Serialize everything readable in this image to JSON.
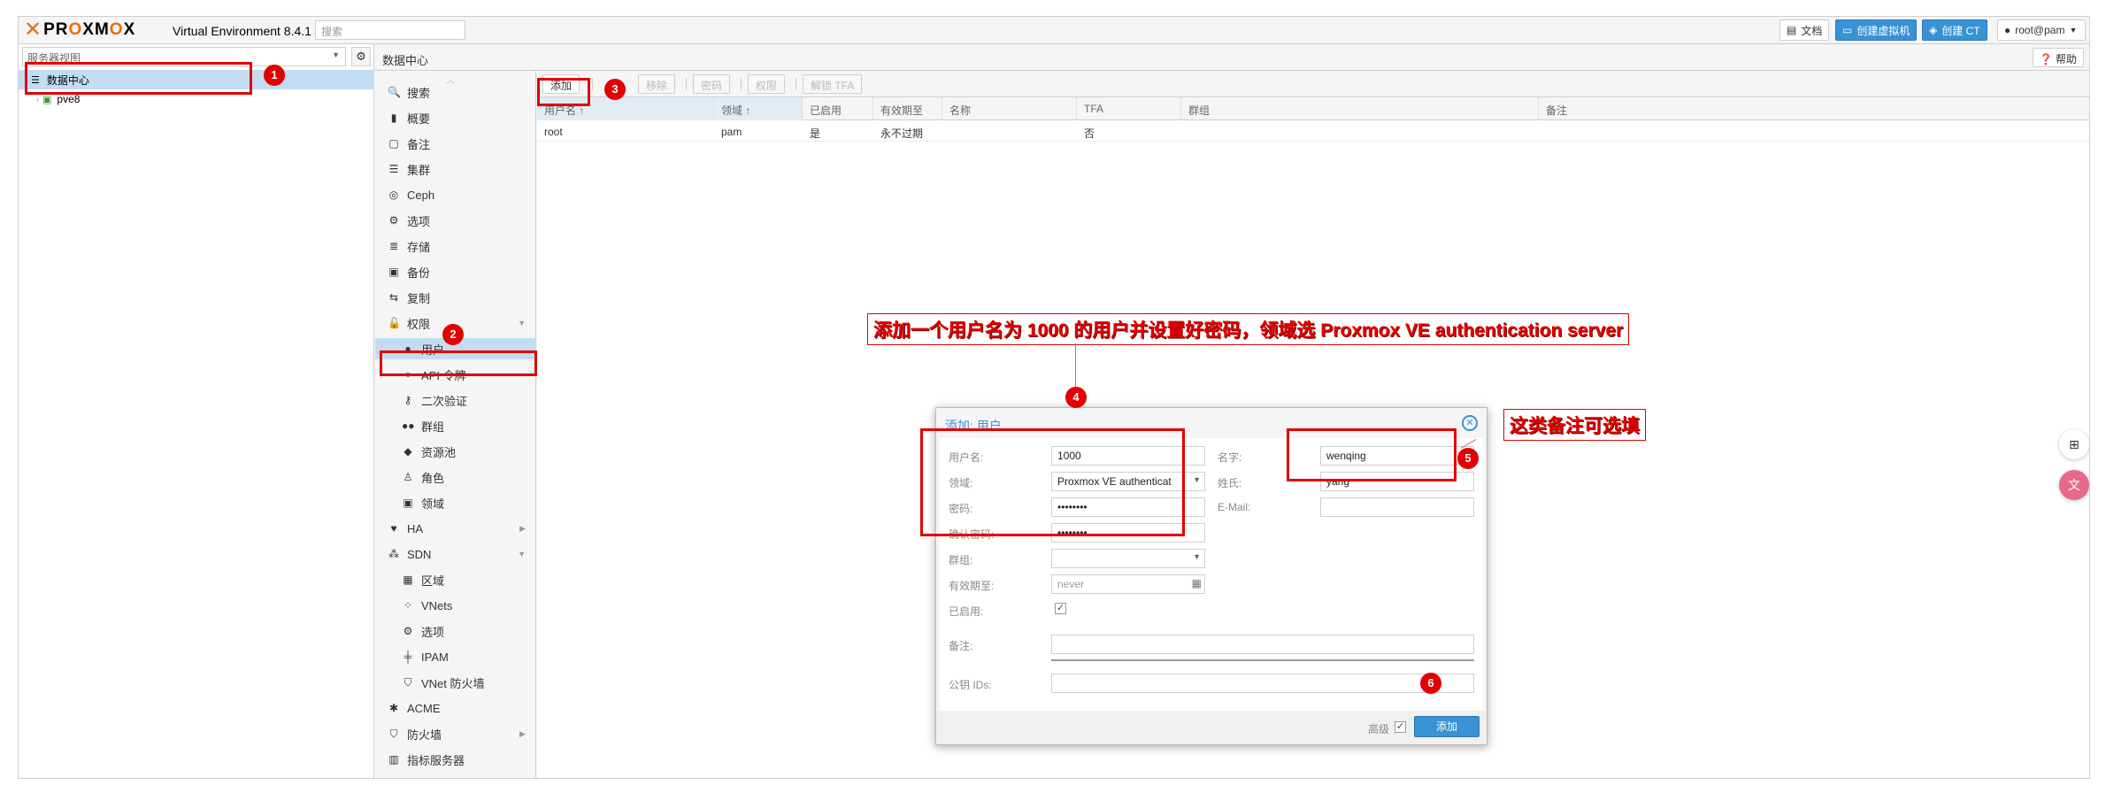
{
  "app": {
    "logo": "PROXMOX",
    "version": "Virtual Environment 8.4.1",
    "search_placeholder": "搜索"
  },
  "topbar": {
    "docs": "文档",
    "create_vm": "创建虚拟机",
    "create_ct": "创建 CT",
    "user": "root@pam"
  },
  "left": {
    "view": "服务器视图",
    "tree": [
      {
        "label": "数据中心"
      },
      {
        "label": "pve8"
      }
    ]
  },
  "content": {
    "breadcrumb": "数据中心",
    "help": "帮助"
  },
  "nav": [
    {
      "label": "搜索",
      "icon": "search-icon"
    },
    {
      "label": "概要",
      "icon": "book-icon"
    },
    {
      "label": "备注",
      "icon": "note-icon"
    },
    {
      "label": "集群",
      "icon": "server-icon"
    },
    {
      "label": "Ceph",
      "icon": "ceph-icon"
    },
    {
      "label": "选项",
      "icon": "gear-icon"
    },
    {
      "label": "存储",
      "icon": "database-icon"
    },
    {
      "label": "备份",
      "icon": "floppy-icon"
    },
    {
      "label": "复制",
      "icon": "retweet-icon"
    },
    {
      "label": "权限",
      "icon": "unlock-icon"
    },
    {
      "label": "用户",
      "icon": "user-icon"
    },
    {
      "label": "API 令牌",
      "icon": "user-outline-icon"
    },
    {
      "label": "二次验证",
      "icon": "key-icon"
    },
    {
      "label": "群组",
      "icon": "users-icon"
    },
    {
      "label": "资源池",
      "icon": "tags-icon"
    },
    {
      "label": "角色",
      "icon": "male-icon"
    },
    {
      "label": "领域",
      "icon": "address-book-icon"
    },
    {
      "label": "HA",
      "icon": "heartbeat-icon"
    },
    {
      "label": "SDN",
      "icon": "sdn-icon"
    },
    {
      "label": "区域",
      "icon": "th-icon"
    },
    {
      "label": "VNets",
      "icon": "network-icon"
    },
    {
      "label": "选项",
      "icon": "gear-icon"
    },
    {
      "label": "IPAM",
      "icon": "ipam-icon"
    },
    {
      "label": "VNet 防火墙",
      "icon": "shield-icon"
    },
    {
      "label": "ACME",
      "icon": "acme-icon"
    },
    {
      "label": "防火墙",
      "icon": "shield-icon"
    },
    {
      "label": "指标服务器",
      "icon": "chart-icon"
    }
  ],
  "toolbar": {
    "add": "添加",
    "remove": "移除",
    "password": "密码",
    "permission": "权限",
    "unlock_tfa": "解锁 TFA"
  },
  "grid": {
    "columns": [
      "用户名 ↑",
      "领域 ↑",
      "已启用",
      "有效期至",
      "名称",
      "TFA",
      "群组",
      "备注"
    ],
    "rows": [
      [
        "root",
        "pam",
        "是",
        "永不过期",
        "",
        "否",
        "",
        ""
      ]
    ]
  },
  "dialog": {
    "title": "添加: 用户",
    "username_label": "用户名:",
    "username": "1000",
    "realm_label": "领域:",
    "realm": "Proxmox VE authenticat",
    "password_label": "密码:",
    "password": "••••••••",
    "confirm_label": "确认密码:",
    "confirm": "••••••••",
    "group_label": "群组:",
    "expire_label": "有效期至:",
    "expire_placeholder": "never",
    "enabled_label": "已启用:",
    "comment_label": "备注:",
    "firstname_label": "名字:",
    "firstname": "wenqing",
    "lastname_label": "姓氏:",
    "lastname": "yang",
    "email_label": "E-Mail:",
    "keys_label": "公钥 IDs:",
    "advanced_label": "高级",
    "add_button": "添加"
  },
  "annotations": {
    "badges": [
      "1",
      "2",
      "3",
      "4",
      "5",
      "6"
    ],
    "callout_main": "添加一个用户名为 1000 的用户并设置好密码，领域选 Proxmox VE authentication server",
    "callout_optional": "这类备注可选填"
  },
  "colors": {
    "accent": "#3892d4",
    "annotation": "#e20000",
    "selection": "#c2ddf2",
    "brand": "#e57000"
  }
}
